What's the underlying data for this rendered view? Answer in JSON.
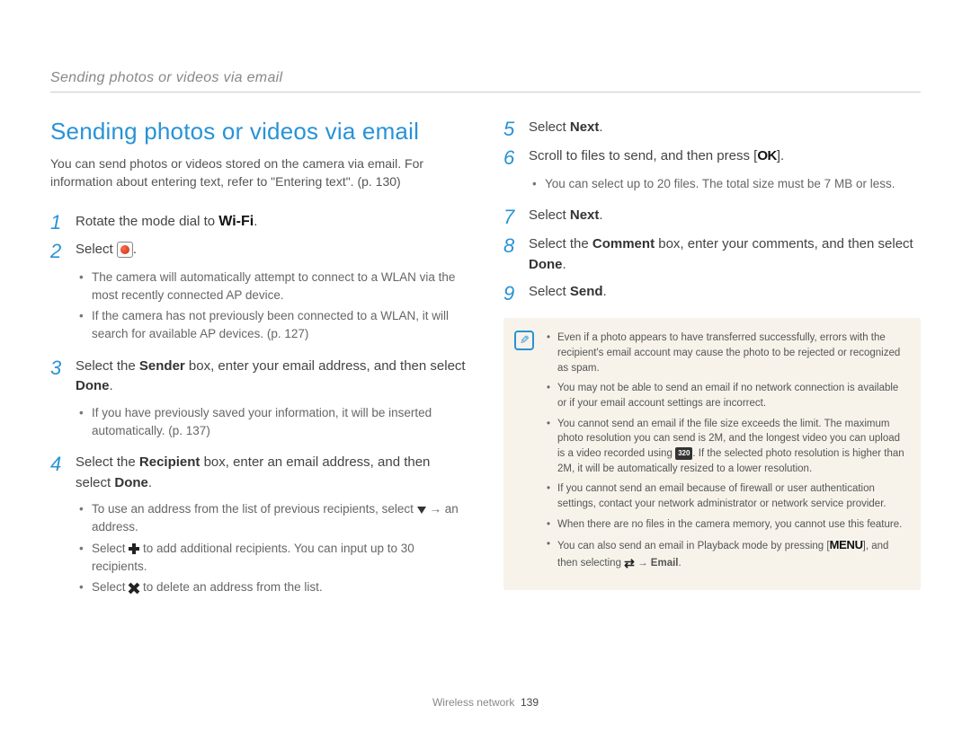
{
  "breadcrumb": "Sending photos or videos via email",
  "title": "Sending photos or videos via email",
  "intro": "You can send photos or videos stored on the camera via email. For information about entering text, refer to \"Entering text\". (p. 130)",
  "steps_left": [
    {
      "num": "1",
      "text_pre": "Rotate the mode dial to ",
      "icon": "wifi",
      "text_post": "."
    },
    {
      "num": "2",
      "text_pre": "Select ",
      "icon": "circle",
      "text_post": ".",
      "subs": [
        "The camera will automatically attempt to connect to a WLAN via the most recently connected AP device.",
        "If the camera has not previously been connected to a WLAN, it will search for available AP devices. (p. 127)"
      ]
    },
    {
      "num": "3",
      "html": "Select the <b>Sender</b> box, enter your email address, and then select <b>Done</b>.",
      "subs": [
        "If you have previously saved your information, it will be inserted automatically. (p. 137)"
      ]
    },
    {
      "num": "4",
      "html": "Select the <b>Recipient</b> box, enter an email address, and then select <b>Done</b>.",
      "subs_html": [
        "To use an address from the list of previous recipients, select <span class=\"down-arrow\" data-name=\"down-arrow-icon\" data-interactable=\"false\"></span> → an address.",
        "Select <span class=\"plus-icon\" data-name=\"plus-icon\" data-interactable=\"false\"></span> to add additional recipients. You can input up to 30 recipients.",
        "Select <span class=\"x-icon\" data-name=\"x-icon\" data-interactable=\"false\"></span> to delete an address from the list."
      ]
    }
  ],
  "steps_right": [
    {
      "num": "5",
      "html": "Select <b>Next</b>."
    },
    {
      "num": "6",
      "text_pre": "Scroll to files to send, and then press [",
      "icon": "ok",
      "text_post": "].",
      "subs": [
        "You can select up to 20 files. The total size must be 7 MB or less."
      ]
    },
    {
      "num": "7",
      "html": "Select <b>Next</b>."
    },
    {
      "num": "8",
      "html": "Select the <b>Comment</b> box, enter your comments, and then select <b>Done</b>."
    },
    {
      "num": "9",
      "html": "Select <b>Send</b>."
    }
  ],
  "notes": [
    "Even if a photo appears to have transferred successfully, errors with the recipient's email account may cause the photo to be rejected or recognized as spam.",
    "You may not be able to send an email if no network connection is available or if your email account settings are incorrect.",
    "You cannot send an email if the file size exceeds the limit. The maximum photo resolution you can send is 2M, and the longest video you can upload is a video recorded using <span class=\"badge-icon\" data-name=\"video-badge-icon\" data-interactable=\"false\">320</span>. If the selected photo resolution is higher than 2M, it will be automatically resized to a lower resolution.",
    "If you cannot send an email because of firewall or user authentication settings, contact your network administrator or network service provider.",
    "When there are no files in the camera memory, you cannot use this feature.",
    "You can also send an email in Playback mode by pressing [<span class=\"menu-icon\" data-name=\"menu-icon\" data-interactable=\"false\">MENU</span>], and then selecting <span class=\"swap-icon\" data-name=\"swap-icon\" data-interactable=\"false\">⇄</span> → <b>Email</b>."
  ],
  "footer_section": "Wireless network",
  "footer_page": "139"
}
